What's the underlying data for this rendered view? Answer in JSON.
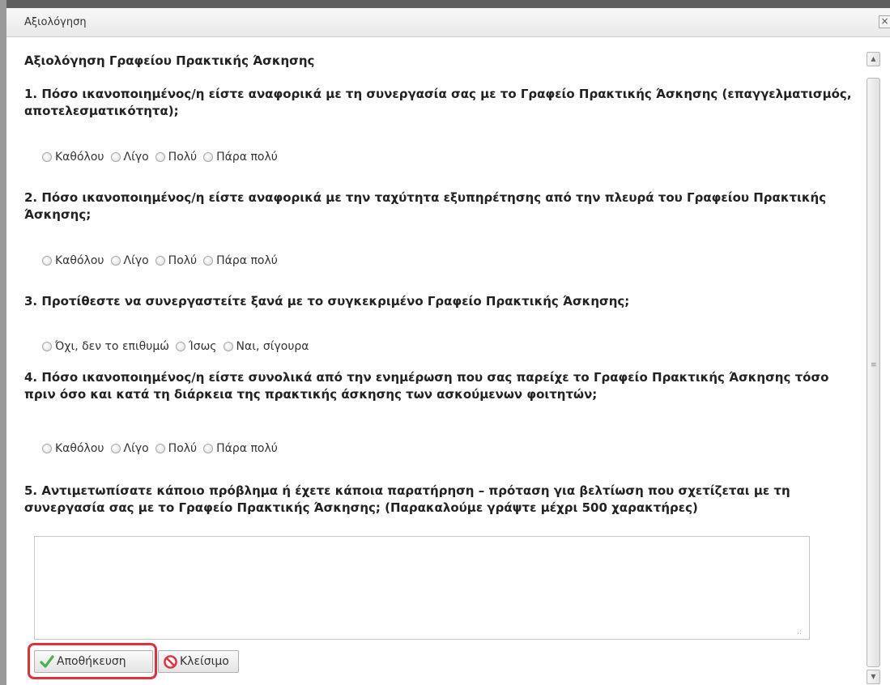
{
  "window": {
    "title": "Αξιολόγηση",
    "close_glyph": "×"
  },
  "form": {
    "heading": "Αξιολόγηση Γραφείου Πρακτικής Άσκησης",
    "questions": [
      {
        "text": "1. Πόσο ικανοποιημένος/η είστε αναφορικά με τη συνεργασία σας με το Γραφείο Πρακτικής Άσκησης (επαγγελματισμός, αποτελεσματικότητα);",
        "options": [
          "Καθόλου",
          "Λίγο",
          "Πολύ",
          "Πάρα πολύ"
        ]
      },
      {
        "text": "2. Πόσο ικανοποιημένος/η είστε αναφορικά με την ταχύτητα εξυπηρέτησης από την πλευρά του Γραφείου Πρακτικής Άσκησης;",
        "options": [
          "Καθόλου",
          "Λίγο",
          "Πολύ",
          "Πάρα πολύ"
        ]
      },
      {
        "text": "3. Προτίθεστε να συνεργαστείτε ξανά με το συγκεκριμένο Γραφείο Πρακτικής Άσκησης;",
        "options": [
          "Όχι, δεν το επιθυμώ",
          "Ίσως",
          "Ναι, σίγουρα"
        ]
      },
      {
        "text": "4. Πόσο ικανοποιημένος/η είστε συνολικά από την ενημέρωση που σας παρείχε το Γραφείο Πρακτικής Άσκησης τόσο πριν όσο και κατά τη διάρκεια της πρακτικής άσκησης των ασκούμενων φοιτητών;",
        "options": [
          "Καθόλου",
          "Λίγο",
          "Πολύ",
          "Πάρα πολύ"
        ]
      },
      {
        "text": "5. Αντιμετωπίσατε κάποιο πρόβλημα ή έχετε κάποια παρατήρηση – πρόταση για βελτίωση που σχετίζεται με τη συνεργασία σας με το Γραφείο Πρακτικής Άσκησης; (Παρακαλούμε γράψτε μέχρι 500 χαρακτήρες)"
      }
    ],
    "comment_value": ""
  },
  "buttons": {
    "save_label": "Αποθήκευση",
    "close_label": "Κλείσιμο"
  },
  "colors": {
    "highlight": "#e0303c",
    "save_icon": "#4caf50",
    "close_icon": "#e0303c"
  },
  "icons": {
    "save": "check-icon",
    "close": "no-entry-icon"
  }
}
